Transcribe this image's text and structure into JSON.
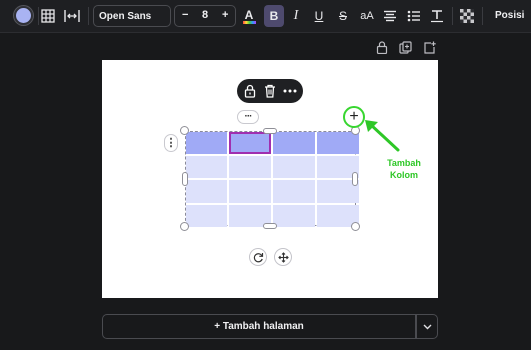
{
  "toolbar": {
    "font_name": "Open Sans",
    "font_size": "8",
    "decrease_label": "−",
    "increase_label": "+",
    "text_color_label": "A",
    "bold_label": "B",
    "italic_label": "I",
    "underline_label": "U",
    "strike_label": "S",
    "case_label": "aA",
    "position_label": "Posisi"
  },
  "colors": {
    "fill_swatch": "#a9b3f3",
    "header_cells": "#a0aaf6",
    "body_cells": "#dde1fb",
    "selected_cell_border": "#a02fb0",
    "annotation": "#2ec727"
  },
  "canvas": {
    "row_menu_label": "⋮",
    "column_menu_label": "···",
    "add_column_label": "+",
    "annotation_text": "Tambah Kolom"
  },
  "table": {
    "rows": 4,
    "columns": 4,
    "selected_cell": [
      0,
      1
    ]
  },
  "footer": {
    "add_page_label": "+ Tambah halaman"
  }
}
